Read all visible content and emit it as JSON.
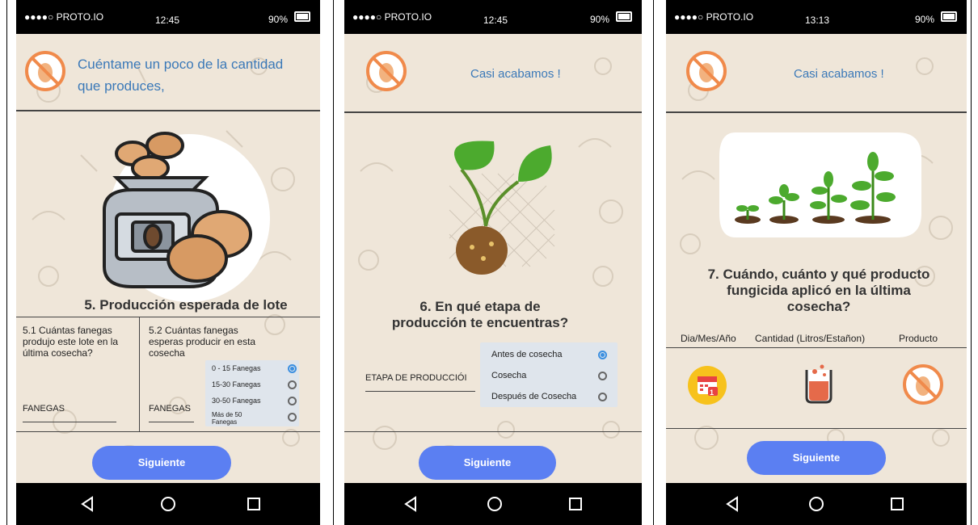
{
  "status": {
    "carrier": "●●●●○ PROTO.IO",
    "battery": "90%",
    "times": [
      "12:45",
      "12:45",
      "13:13"
    ]
  },
  "screen1": {
    "header": "Cuéntame  un poco de la cantidad que produces,",
    "title": "5. Producción esperada de lote",
    "q1": "5.1 Cuántas fanegas produjo este lote en la última cosecha?",
    "q2": "5.2 Cuántas fanegas esperas producir en esta cosecha",
    "field1": "FANEGAS",
    "field2": "FANEGAS",
    "options": [
      "0 - 15 Fanegas",
      "15-30 Fanegas",
      "30-50 Fanegas",
      "Más de 50 Fanegas"
    ],
    "selected_index": 0,
    "button": "Siguiente"
  },
  "screen2": {
    "header": "Casi acabamos !",
    "title": "6. En qué etapa de producción te encuentras?",
    "field": "ETAPA DE PRODUCCIÓI",
    "options": [
      "Antes de cosecha",
      "Cosecha",
      "Después de Cosecha"
    ],
    "selected_index": 0,
    "button": "Siguiente"
  },
  "screen3": {
    "header": "Casi acabamos !",
    "title": "7. Cuándo, cuánto y  qué producto fungicida aplicó en la última cosecha?",
    "col1": "Dia/Mes/Año",
    "col2": "Cantidad (Litros/Estañon)",
    "col3": "Producto",
    "calendar_badge": "1",
    "button": "Siguiente"
  }
}
